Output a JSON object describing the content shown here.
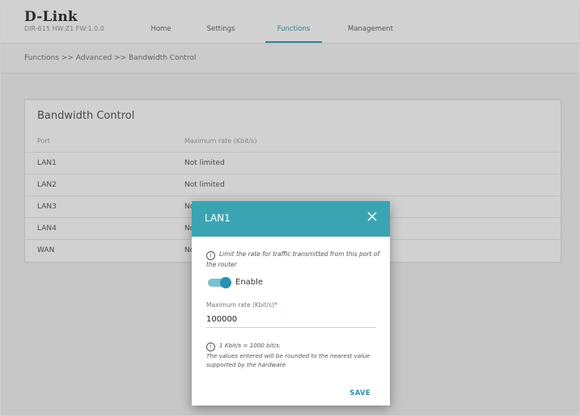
{
  "header": {
    "logo": "D-Link",
    "hw_info": "DIR-615 HW:Z1 FW:1.0.0",
    "nav": [
      {
        "label": "Home",
        "active": false
      },
      {
        "label": "Settings",
        "active": false
      },
      {
        "label": "Functions",
        "active": true
      },
      {
        "label": "Management",
        "active": false
      }
    ]
  },
  "breadcrumb": "Functions >> Advanced >> Bandwidth Control",
  "card": {
    "title": "Bandwidth Control",
    "columns": [
      "Port",
      "Maximum rate (Kbit/s)"
    ],
    "rows": [
      {
        "port": "LAN1",
        "rate": "Not limited"
      },
      {
        "port": "LAN2",
        "rate": "Not limited"
      },
      {
        "port": "LAN3",
        "rate": "Not limited"
      },
      {
        "port": "LAN4",
        "rate": "Not limited"
      },
      {
        "port": "WAN",
        "rate": "Not limited"
      }
    ]
  },
  "dialog": {
    "title": "LAN1",
    "close_icon": "close-icon",
    "note1": "Limit the rate for traffic transmitted from this port of the router",
    "enable_label": "Enable",
    "enabled": true,
    "field_label": "Maximum rate (Kbit/s)",
    "field_required_mark": "*",
    "field_value": "100000",
    "note2_line1": "1 Kbit/s = 1000 bit/s.",
    "note2_line2": "The values entered will be rounded to the nearest value supported by the hardware",
    "save_label": "SAVE"
  },
  "colors": {
    "accent": "#2a92a7",
    "dialog_header": "#3ba4b3",
    "toggle_track": "#7cbfd0",
    "toggle_knob": "#2d8fb0",
    "required": "#e03030"
  }
}
